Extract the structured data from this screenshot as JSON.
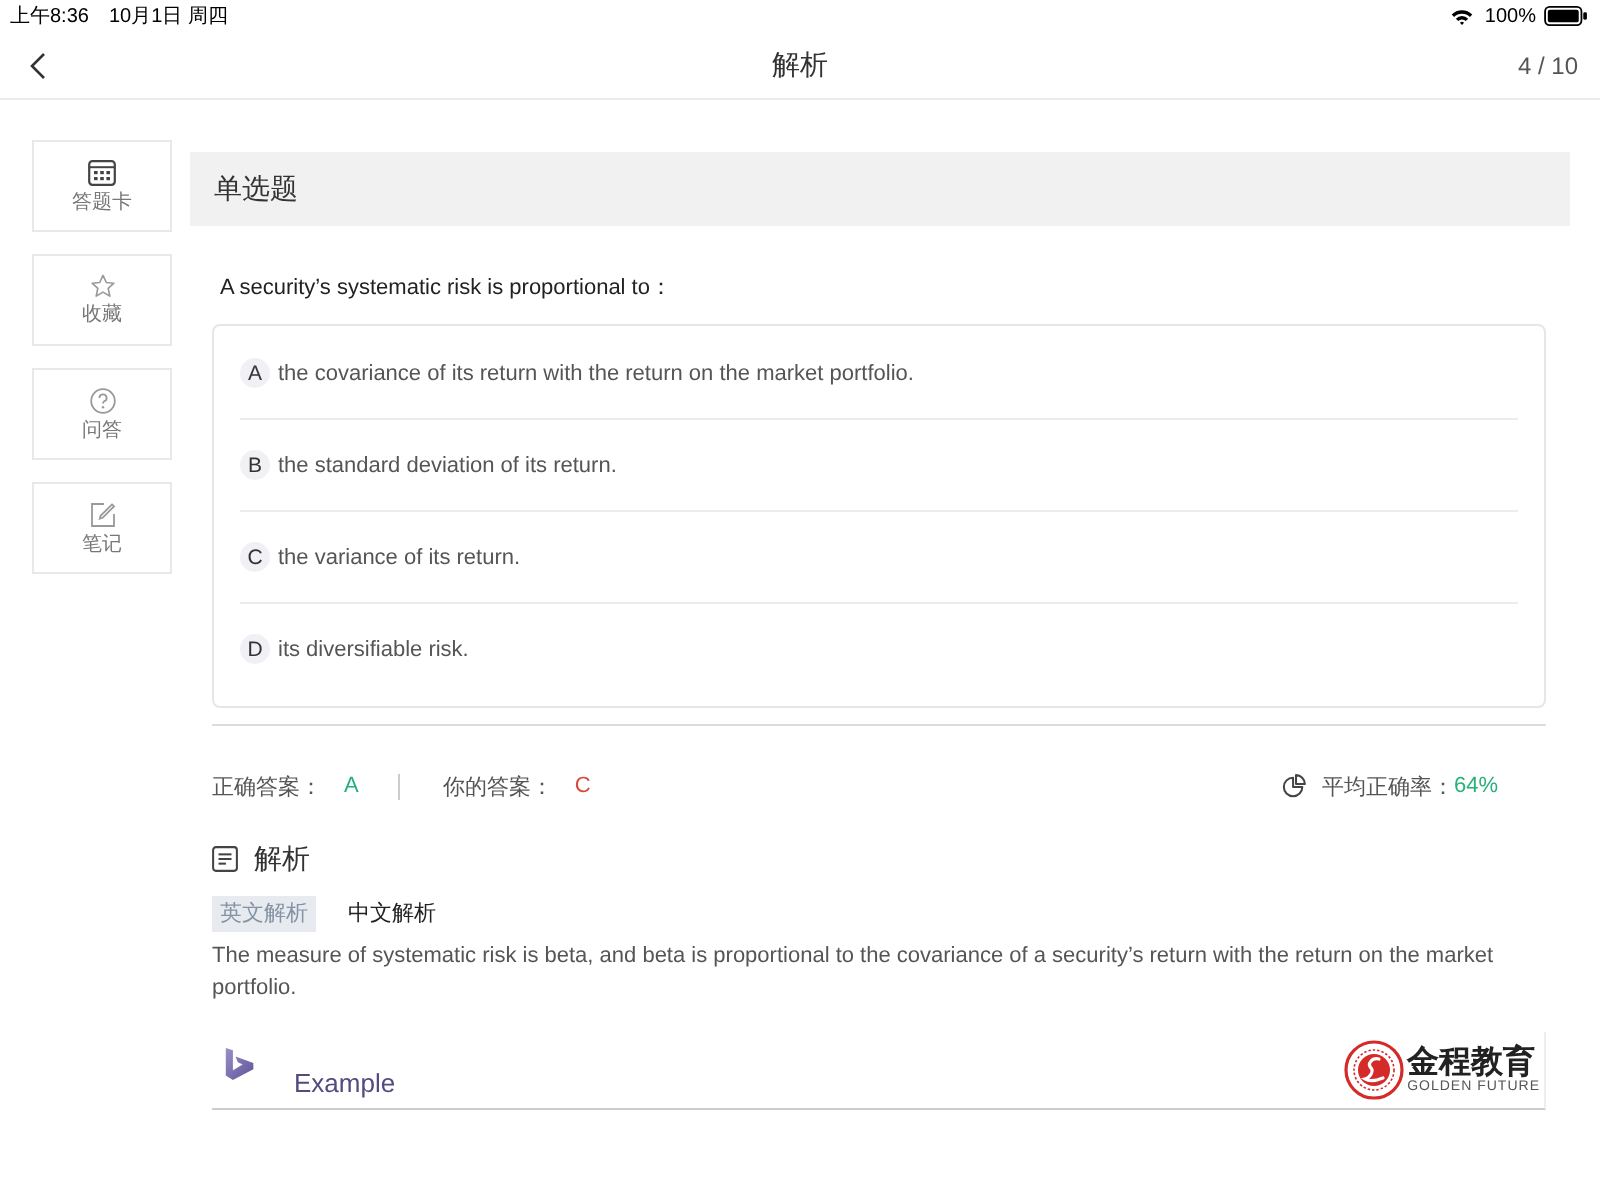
{
  "status_bar": {
    "time": "上午8:36",
    "date": "10月1日 周四",
    "battery": "100%"
  },
  "nav": {
    "title": "解析",
    "progress": "4 / 10"
  },
  "sidebar": {
    "items": [
      {
        "kind": "card",
        "label": "答题卡"
      },
      {
        "kind": "star",
        "label": "收藏"
      },
      {
        "kind": "question",
        "label": "问答"
      },
      {
        "kind": "note",
        "label": "笔记"
      }
    ]
  },
  "question": {
    "type": "单选题",
    "stem": "A security’s systematic risk is proportional to：",
    "options": [
      {
        "letter": "A",
        "text": "the covariance of its return with the return on the market portfolio."
      },
      {
        "letter": "B",
        "text": "the standard deviation of its return."
      },
      {
        "letter": "C",
        "text": "the variance of its return."
      },
      {
        "letter": "D",
        "text": "its diversifiable risk."
      }
    ]
  },
  "answer": {
    "correct_label": "正确答案：",
    "correct": "A",
    "yours_label": "你的答案：",
    "yours": "C",
    "average_label": "平均正确率：",
    "average": "64%"
  },
  "explanation": {
    "title": "解析",
    "tabs": [
      {
        "label": "英文解析",
        "selected": true
      },
      {
        "label": "中文解析",
        "selected": false
      }
    ],
    "text": "The measure of systematic risk is beta, and beta is proportional to the covariance of a security’s return with the return on the market portfolio.",
    "banner": {
      "caption": "Example",
      "brand": "金程教育",
      "brand_sub": "GOLDEN FUTURE"
    }
  }
}
